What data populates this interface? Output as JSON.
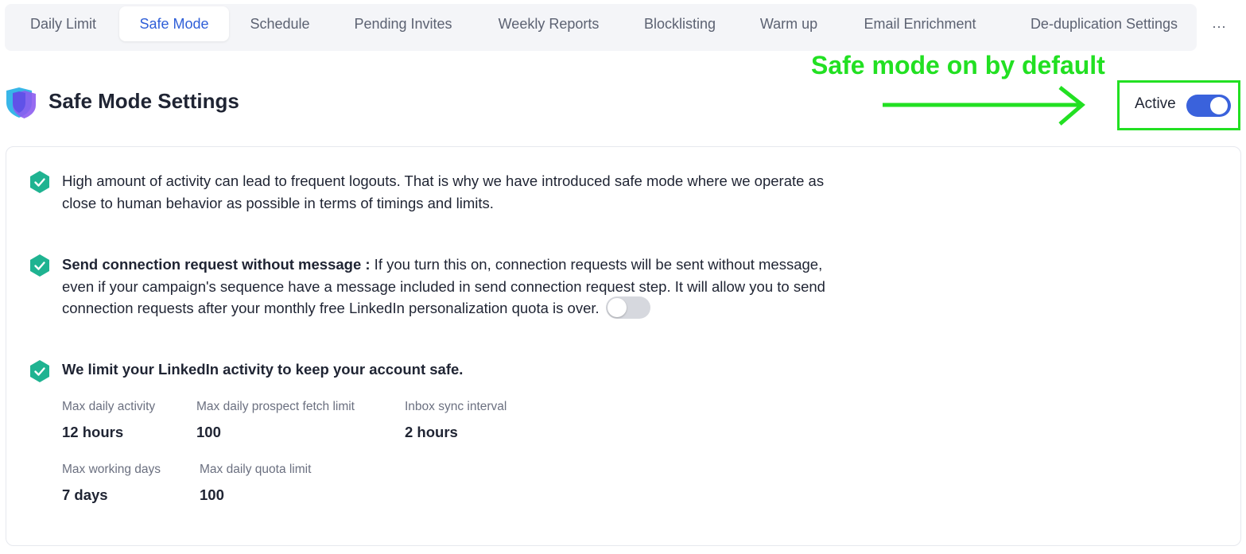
{
  "tabs": [
    {
      "label": "Daily Limit",
      "active": false
    },
    {
      "label": "Safe Mode",
      "active": true
    },
    {
      "label": "Schedule",
      "active": false
    },
    {
      "label": "Pending Invites",
      "active": false
    },
    {
      "label": "Weekly Reports",
      "active": false
    },
    {
      "label": "Blocklisting",
      "active": false
    },
    {
      "label": "Warm up",
      "active": false
    },
    {
      "label": "Email Enrichment",
      "active": false
    },
    {
      "label": "De-duplication Settings",
      "active": false
    }
  ],
  "more_label": "···",
  "header": {
    "title": "Safe Mode Settings",
    "status_label": "Active",
    "status_on": true,
    "icon": "shield-icon"
  },
  "annotation": {
    "text": "Safe mode on by default",
    "color": "#22e022"
  },
  "items": {
    "intro": "High amount of activity can lead to frequent logouts. That is why we have introduced safe mode where we operate as close to human behavior as possible in terms of timings and limits.",
    "connection_title": "Send connection request without message :",
    "connection_body": " If you turn this on, connection requests will be sent without message, even if your campaign's sequence have a message included in send connection request step. It will allow you to send connection requests after your monthly free LinkedIn personalization quota is over.",
    "connection_toggle_on": false,
    "limits_title": "We limit your LinkedIn activity to keep your account safe."
  },
  "stats": [
    {
      "label": "Max daily activity",
      "value": "12 hours"
    },
    {
      "label": "Max daily prospect fetch limit",
      "value": "100"
    },
    {
      "label": "Inbox sync interval",
      "value": "2 hours"
    },
    {
      "label": "Max working days",
      "value": "7 days"
    },
    {
      "label": "Max daily quota limit",
      "value": "100"
    }
  ],
  "colors": {
    "accent": "#2f5fd8",
    "toggle_on": "#3a62dc",
    "check_green": "#1fb391"
  }
}
